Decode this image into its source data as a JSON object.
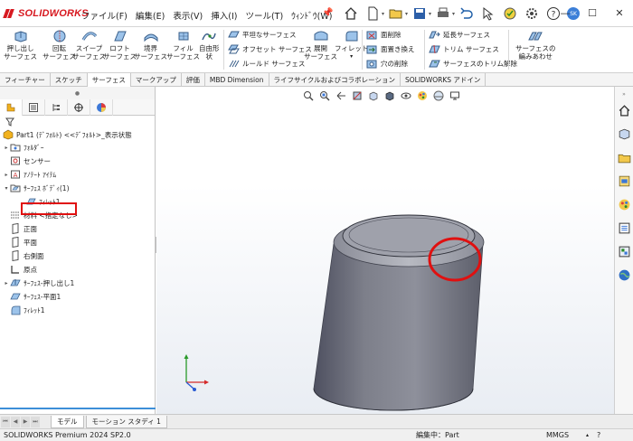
{
  "app": {
    "brand": "SOLIDWORKS"
  },
  "menu": [
    "ファイル(F)",
    "編集(E)",
    "表示(V)",
    "挿入(I)",
    "ツール(T)",
    "ｳｨﾝﾄﾞｳ(W)"
  ],
  "quick_access": {
    "avatar": "SK",
    "icons": [
      "home-icon",
      "new-document-icon",
      "open-folder-icon",
      "save-icon",
      "print-icon",
      "undo-icon",
      "select-arrow-icon",
      "rebuild-icon",
      "options-gear-icon",
      "help-icon",
      "user-avatar-icon",
      "minimize-icon",
      "maximize-icon",
      "close-icon"
    ]
  },
  "ribbon": {
    "big": [
      {
        "label1": "押し出し",
        "label2": "サーフェス",
        "icon": "extruded-surface-icon"
      },
      {
        "label1": "回転",
        "label2": "サーフェス",
        "icon": "revolved-surface-icon"
      },
      {
        "label1": "スイープ",
        "label2": "サーフェス",
        "icon": "swept-surface-icon"
      },
      {
        "label1": "ロフト",
        "label2": "サーフェス",
        "icon": "lofted-surface-icon"
      },
      {
        "label1": "境界",
        "label2": "サーフェス",
        "icon": "boundary-surface-icon"
      },
      {
        "label1": "フィル",
        "label2": "サーフェス",
        "icon": "filled-surface-icon"
      },
      {
        "label1": "自由形",
        "label2": "状",
        "icon": "freeform-icon"
      },
      {
        "label1": "展開",
        "label2": "サーフェス",
        "icon": "flatten-surface-icon"
      },
      {
        "label1": "フィレット",
        "label2": "",
        "icon": "fillet-icon"
      },
      {
        "label1": "サーフェスの",
        "label2": "編みあわせ",
        "icon": "knit-surface-icon"
      }
    ],
    "small": [
      {
        "label": "平坦なサーフェス",
        "icon": "planar-surface-icon"
      },
      {
        "label": "オフセット サーフェス",
        "icon": "offset-surface-icon"
      },
      {
        "label": "ルールド サーフェス",
        "icon": "ruled-surface-icon"
      },
      {
        "label": "面削除",
        "icon": "delete-face-icon"
      },
      {
        "label": "面置き換え",
        "icon": "replace-face-icon"
      },
      {
        "label": "穴の削除",
        "icon": "delete-hole-icon"
      },
      {
        "label": "延長サーフェス",
        "icon": "extend-surface-icon"
      },
      {
        "label": "トリム サーフェス",
        "icon": "trim-surface-icon"
      },
      {
        "label": "サーフェスのトリム解除",
        "icon": "untrim-surface-icon"
      }
    ]
  },
  "tabs": [
    "フィーチャー",
    "スケッチ",
    "サーフェス",
    "マークアップ",
    "評価",
    "MBD Dimension",
    "ライフサイクルおよびコラボレーション",
    "SOLIDWORKS アドイン"
  ],
  "active_tab": "サーフェス",
  "tree": {
    "root": "Part1 (ﾃﾞﾌｫﾙﾄ) <<ﾃﾞﾌｫﾙﾄ>_表示状態",
    "items": [
      {
        "label": "ﾌｫﾙﾀﾞｰ",
        "icon": "folder-icon",
        "expander": "▸"
      },
      {
        "label": "センサー",
        "icon": "sensor-icon",
        "expander": ""
      },
      {
        "label": "ｱﾉﾃｰﾄ ｱｲﾃﾑ",
        "icon": "annotation-icon",
        "expander": "▸"
      },
      {
        "label": "ｻｰﾌｪｽ ﾎﾞﾃﾞｨ(1)",
        "icon": "surface-bodies-folder-icon",
        "expander": "▾"
      },
      {
        "label": "ﾌｨﾚｯﾄ1",
        "icon": "fillet-surface-icon",
        "expander": ""
      },
      {
        "label": "材料 <指定なし>",
        "icon": "material-icon",
        "expander": ""
      },
      {
        "label": "正面",
        "icon": "plane-icon",
        "expander": ""
      },
      {
        "label": "平面",
        "icon": "plane-icon",
        "expander": ""
      },
      {
        "label": "右側面",
        "icon": "plane-icon",
        "expander": ""
      },
      {
        "label": "原点",
        "icon": "origin-icon",
        "expander": ""
      },
      {
        "label": "ｻｰﾌｪｽ-押し出し1",
        "icon": "extrude-feature-icon",
        "expander": "▸"
      },
      {
        "label": "ｻｰﾌｪｽ-平面1",
        "icon": "planar-feature-icon",
        "expander": ""
      },
      {
        "label": "ﾌｨﾚｯﾄ1",
        "icon": "fillet-feature-icon",
        "expander": ""
      }
    ]
  },
  "bottom_tabs": [
    "モデル",
    "モーション スタディ 1"
  ],
  "status": {
    "version": "SOLIDWORKS Premium 2024 SP2.0",
    "mode": "編集中：Part",
    "units": "MMGS"
  },
  "colors": {
    "brand_red": "#d71920",
    "model_gray": "#7d7f8a",
    "highlight_red": "#e01010",
    "selection_blue": "#3d8fd8"
  }
}
